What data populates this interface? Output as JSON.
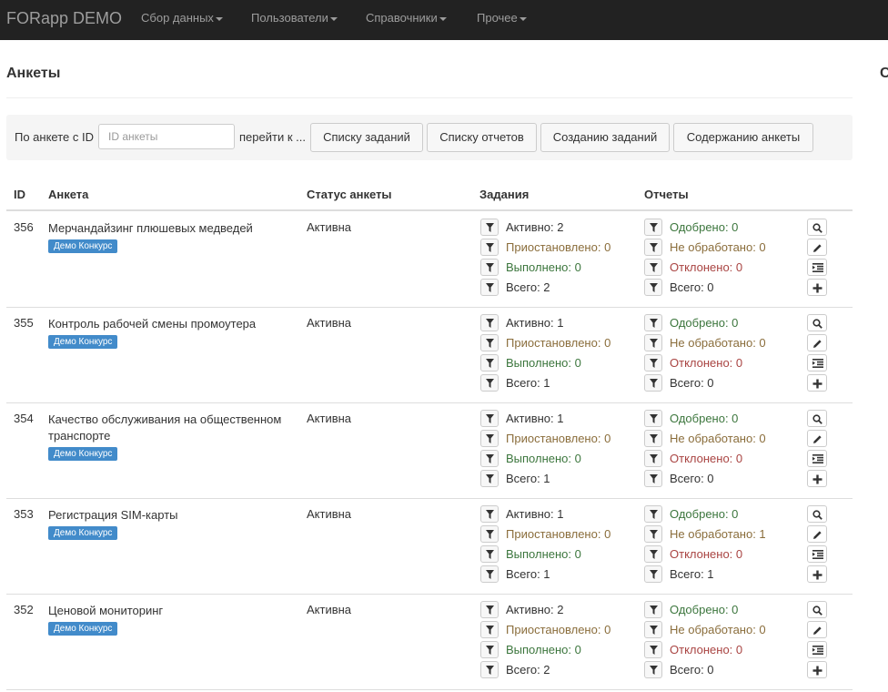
{
  "navbar": {
    "brand": "FORapp DEMO",
    "items": [
      {
        "label": "Сбор данных"
      },
      {
        "label": "Пользователи"
      },
      {
        "label": "Справочники"
      },
      {
        "label": "Прочее"
      }
    ]
  },
  "page": {
    "title": "Анкеты",
    "side_char": "С"
  },
  "filter": {
    "by_id_label": "По анкете с ID",
    "input_placeholder": "ID анкеты",
    "goto_label": "перейти к ...",
    "buttons": [
      "Списку заданий",
      "Списку отчетов",
      "Созданию заданий",
      "Содержанию анкеты"
    ]
  },
  "table": {
    "headers": {
      "id": "ID",
      "name": "Анкета",
      "status": "Статус анкеты",
      "tasks": "Задания",
      "reports": "Отчеты"
    },
    "rows": [
      {
        "id": "356",
        "name": "Мерчандайзинг плюшевых медведей",
        "badge": "Демо Конкурс",
        "status": "Активна",
        "tasks": [
          "Активно: 2",
          "Приостановлено: 0",
          "Выполнено: 0",
          "Всего: 2"
        ],
        "reports": [
          "Одобрено: 0",
          "Не обработано: 0",
          "Отклонено: 0",
          "Всего: 0"
        ]
      },
      {
        "id": "355",
        "name": "Контроль рабочей смены промоутера",
        "badge": "Демо Конкурс",
        "status": "Активна",
        "tasks": [
          "Активно: 1",
          "Приостановлено: 0",
          "Выполнено: 0",
          "Всего: 1"
        ],
        "reports": [
          "Одобрено: 0",
          "Не обработано: 0",
          "Отклонено: 0",
          "Всего: 0"
        ]
      },
      {
        "id": "354",
        "name": "Качество обслуживания на общественном транспорте",
        "badge": "Демо Конкурс",
        "status": "Активна",
        "tasks": [
          "Активно: 1",
          "Приостановлено: 0",
          "Выполнено: 0",
          "Всего: 1"
        ],
        "reports": [
          "Одобрено: 0",
          "Не обработано: 0",
          "Отклонено: 0",
          "Всего: 0"
        ]
      },
      {
        "id": "353",
        "name": "Регистрация SIM-карты",
        "badge": "Демо Конкурс",
        "status": "Активна",
        "tasks": [
          "Активно: 1",
          "Приостановлено: 0",
          "Выполнено: 0",
          "Всего: 1"
        ],
        "reports": [
          "Одобрено: 0",
          "Не обработано: 1",
          "Отклонено: 0",
          "Всего: 1"
        ]
      },
      {
        "id": "352",
        "name": "Ценовой мониторинг",
        "badge": "Демо Конкурс",
        "status": "Активна",
        "tasks": [
          "Активно: 2",
          "Приостановлено: 0",
          "Выполнено: 0",
          "Всего: 2"
        ],
        "reports": [
          "Одобрено: 0",
          "Не обработано: 0",
          "Отклонено: 0",
          "Всего: 0"
        ]
      }
    ]
  },
  "colors": {
    "green": "#3c763d",
    "amber": "#8a6d3b",
    "red": "#a94442",
    "badge": "#428bca",
    "navbar": "#222222"
  },
  "icons": {
    "filter": "filter-icon",
    "row_actions": [
      "search-icon",
      "pencil-icon",
      "indent-icon",
      "plus-icon"
    ]
  }
}
